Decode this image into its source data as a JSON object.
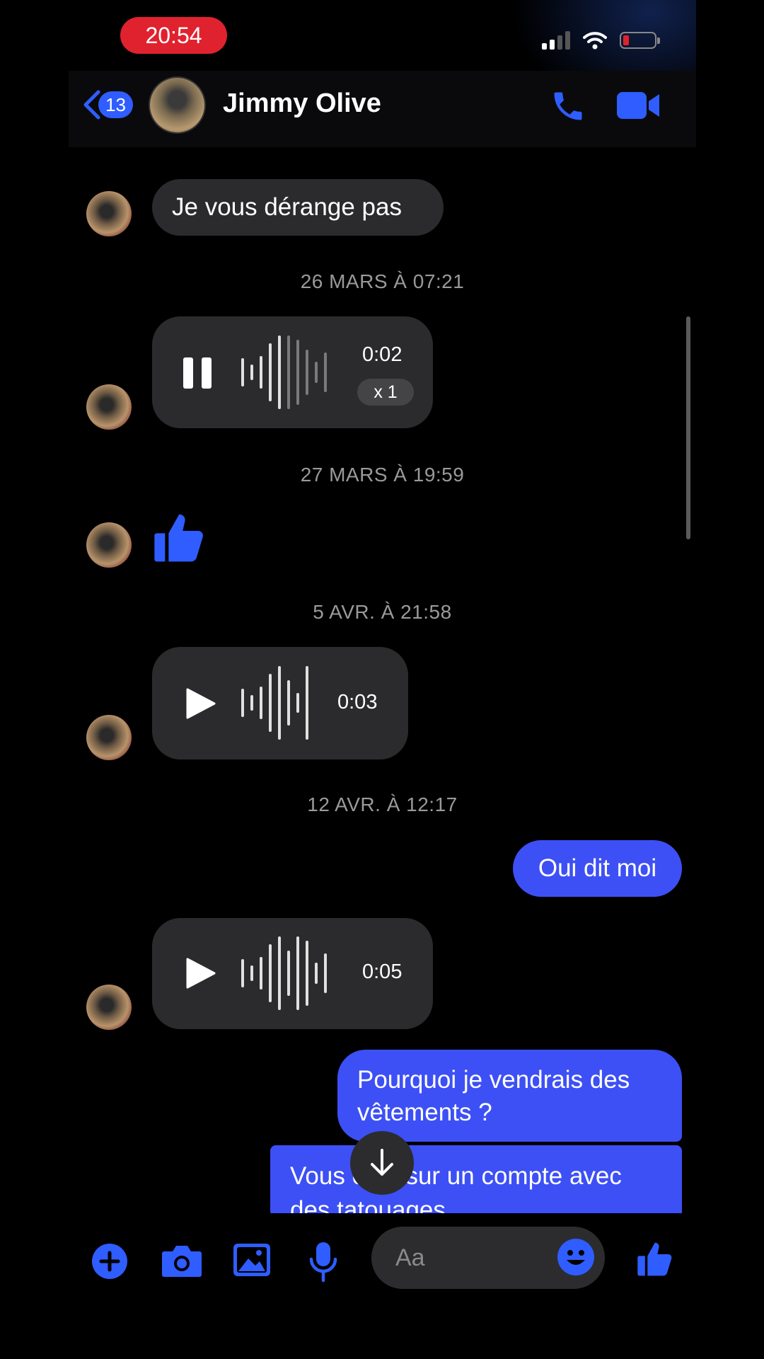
{
  "status_bar": {
    "time": "20:54"
  },
  "header": {
    "back_count": "13",
    "contact_name": "Jimmy Olive"
  },
  "messages": {
    "m1_text": "Je vous dérange pas",
    "ts1": "26 MARS À 07:21",
    "voice1": {
      "duration": "0:02",
      "speed": "x 1",
      "state": "playing"
    },
    "ts2": "27 MARS À 19:59",
    "ts3": "5 AVR. À 21:58",
    "voice2": {
      "duration": "0:03",
      "state": "paused"
    },
    "ts4": "12 AVR. À 12:17",
    "out1": "Oui dit moi",
    "voice3": {
      "duration": "0:05",
      "state": "paused"
    },
    "out2": "Pourquoi je vendrais des vêtements ?",
    "out3": "Vous êtes sur un compte avec des tatouages"
  },
  "composer": {
    "placeholder": "Aa"
  },
  "colors": {
    "accent": "#3d50f5",
    "icon_blue": "#2f5dff",
    "incoming_bubble": "#2b2b2d",
    "time_pill": "#e0222f"
  }
}
